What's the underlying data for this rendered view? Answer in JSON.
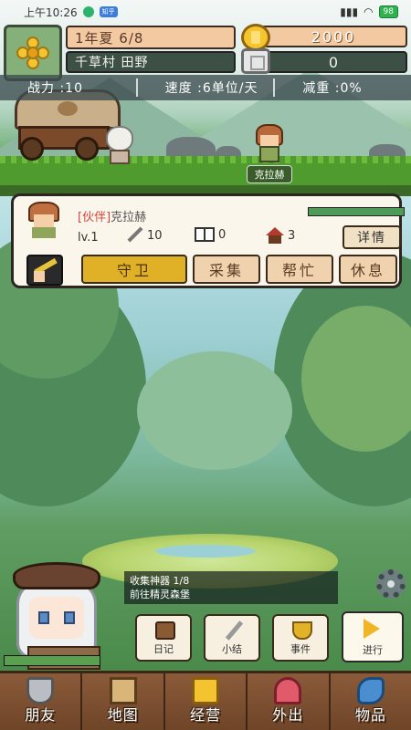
{
  "status_bar": {
    "time": "上午10:26",
    "app_badge": "知乎",
    "battery": "98"
  },
  "header": {
    "date": "1年夏 6/8",
    "location": "千草村 田野",
    "gold": "2000",
    "silver": "0"
  },
  "stats": {
    "power": "战力 :10",
    "speed": "速度 :6单位/天",
    "reduction": "减重 :0%"
  },
  "npc": {
    "name": "克拉赫"
  },
  "companion": {
    "tag": "[伙伴]",
    "name": "克拉赫",
    "level": "lv.1",
    "attack": "10",
    "books": "0",
    "houses": "3",
    "detail_label": "详情",
    "hp_fraction": 1.0,
    "actions": [
      "守卫",
      "采集",
      "帮忙",
      "休息"
    ],
    "active_action": "守卫"
  },
  "quest": {
    "line1": "收集神器 1/8",
    "line2": "前往精灵森堡"
  },
  "heroine": {
    "hp_fraction": 1.0
  },
  "quick_buttons": {
    "diary": "日记",
    "summary": "小结",
    "event": "事件",
    "go": "进行"
  },
  "nav": [
    "朋友",
    "地图",
    "经营",
    "外出",
    "物品"
  ],
  "colors": {
    "active_action": "#e0b126",
    "action_bg": "#f0d2ae",
    "nav_bg": "#7a4c2e",
    "hp_green": "#4e9a57"
  }
}
